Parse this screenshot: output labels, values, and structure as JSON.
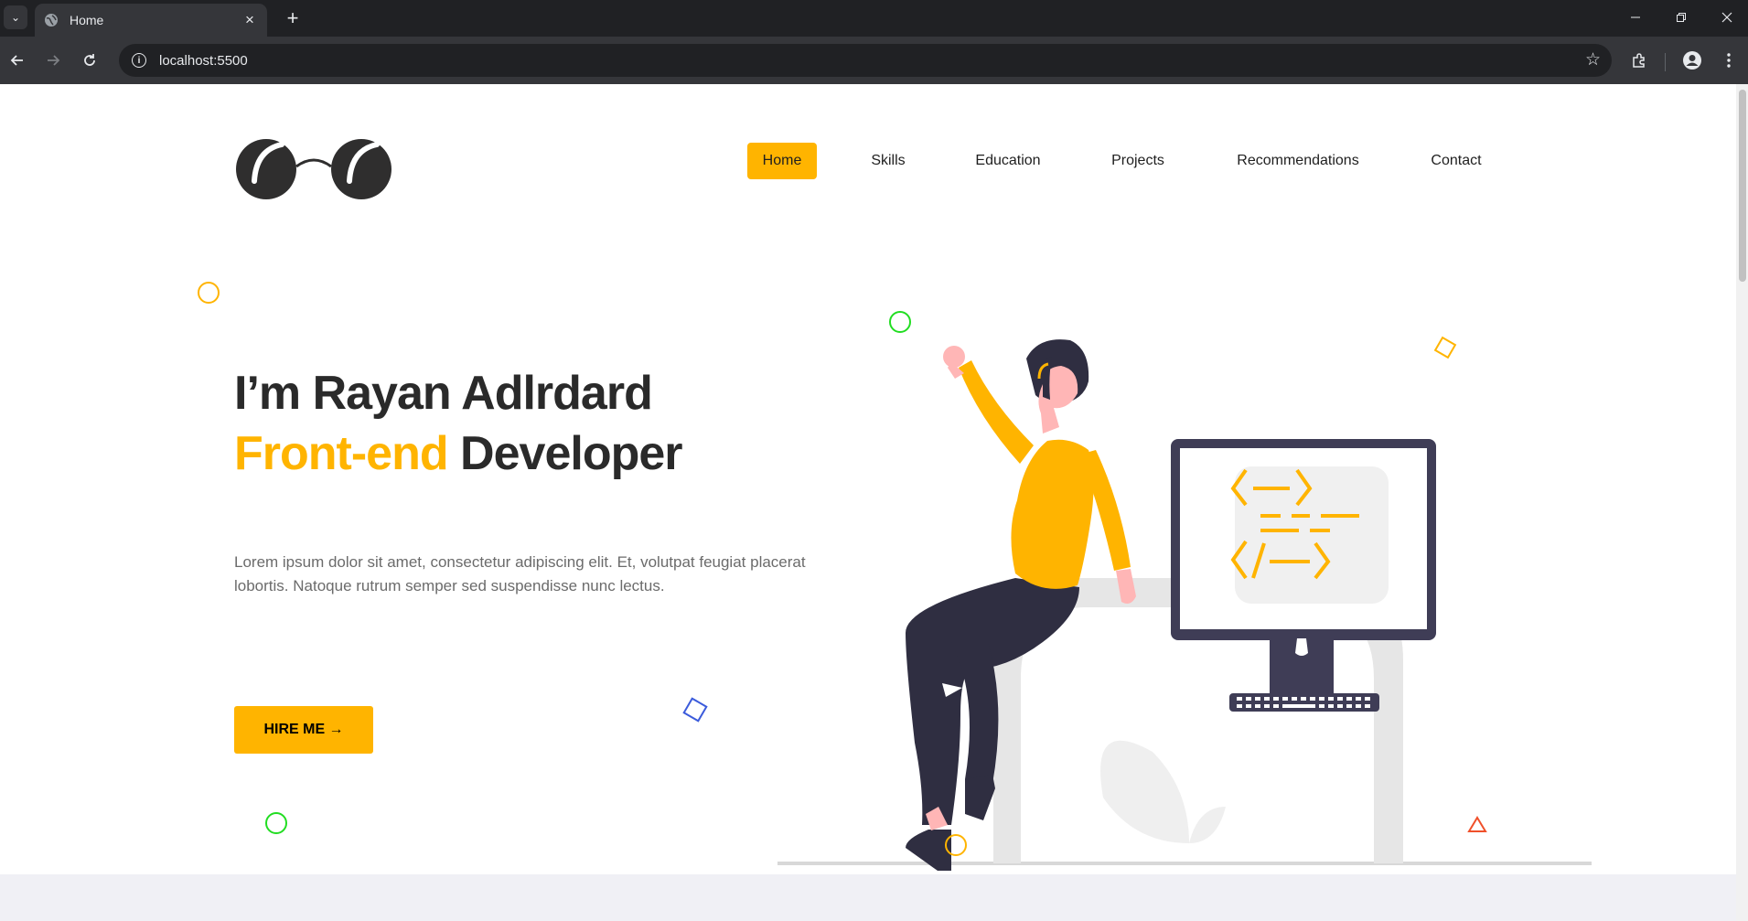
{
  "browser": {
    "tab_title": "Home",
    "url": "localhost:5500"
  },
  "nav": {
    "items": [
      {
        "label": "Home",
        "active": true
      },
      {
        "label": "Skills",
        "active": false
      },
      {
        "label": "Education",
        "active": false
      },
      {
        "label": "Projects",
        "active": false
      },
      {
        "label": "Recommendations",
        "active": false
      },
      {
        "label": "Contact",
        "active": false
      }
    ]
  },
  "hero": {
    "intro": "I’m Rayan Adlrdard",
    "role_highlight": "Front-end",
    "role_rest": " Developer",
    "description": "Lorem ipsum dolor sit amet, consectetur adipiscing elit. Et, volutpat feugiat placerat lobortis. Natoque rutrum semper sed suspendisse nunc lectus.",
    "cta_label": "HIRE ME →"
  },
  "colors": {
    "accent": "#ffb400",
    "dark": "#2f2e41",
    "green_deco": "#22dd22",
    "blue_deco": "#3b5bdb",
    "red_deco": "#f0502a"
  },
  "icons": {
    "logo": "sunglasses-logo",
    "illustration": "woman-sitting-at-computer-illustration"
  }
}
